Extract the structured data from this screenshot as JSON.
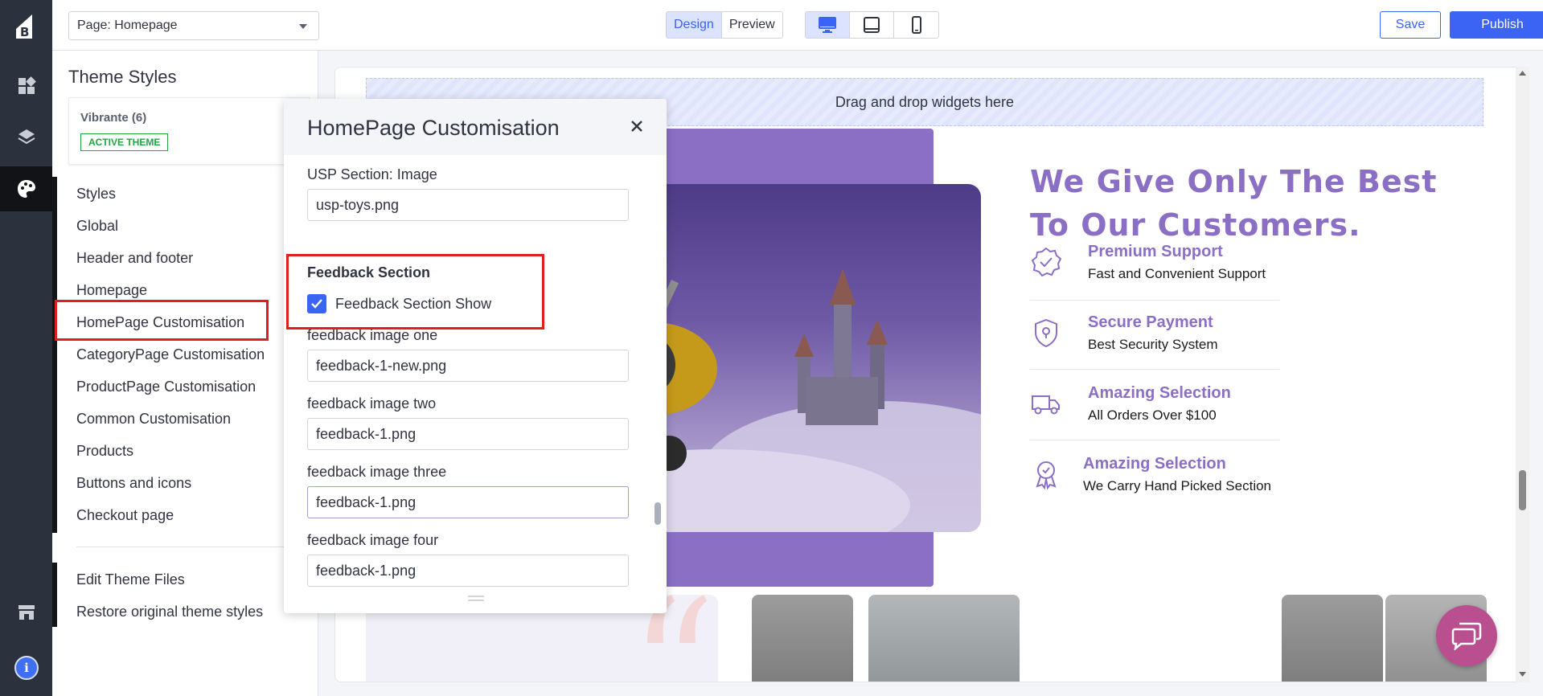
{
  "toolbar": {
    "page_select_value": "Page: Homepage",
    "mode_design": "Design",
    "mode_preview": "Preview",
    "save_label": "Save",
    "publish_label": "Publish"
  },
  "rail": {
    "icons": [
      "bigcommerce-logo-icon",
      "widgets-icon",
      "layers-icon",
      "palette-icon",
      "storefront-icon",
      "info-icon"
    ],
    "info_glyph": "i"
  },
  "sidepanel": {
    "title": "Theme Styles",
    "theme_name": "Vibrante (6)",
    "theme_badge": "ACTIVE THEME",
    "items": [
      "Styles",
      "Global",
      "Header and footer",
      "Homepage",
      "HomePage Customisation",
      "CategoryPage Customisation",
      "ProductPage Customisation",
      "Common Customisation",
      "Products",
      "Buttons and icons",
      "Checkout page"
    ],
    "footer_items": [
      "Edit Theme Files",
      "Restore original theme styles"
    ]
  },
  "modal": {
    "title": "HomePage Customisation",
    "usp_image_label": "USP Section: Image",
    "usp_image_value": "usp-toys.png",
    "feedback_section_label": "Feedback Section",
    "feedback_show_label": "Feedback Section Show",
    "feedback_show_checked": true,
    "fields": [
      {
        "label": "feedback image one",
        "value": "feedback-1-new.png"
      },
      {
        "label": "feedback image two",
        "value": "feedback-1.png"
      },
      {
        "label": "feedback image three",
        "value": "feedback-1.png"
      },
      {
        "label": "feedback image four",
        "value": "feedback-1.png"
      }
    ]
  },
  "preview": {
    "dropzone_text": "Drag and drop widgets here",
    "usp_title": "We Give Only The Best To Our Customers.",
    "usp_items": [
      {
        "title": "Premium Support",
        "subtitle": "Fast and Convenient Support",
        "icon": "badge-check-icon"
      },
      {
        "title": "Secure Payment",
        "subtitle": "Best Security System",
        "icon": "shield-icon"
      },
      {
        "title": "Amazing Selection",
        "subtitle": "All Orders Over $100",
        "icon": "truck-icon"
      },
      {
        "title": "Amazing Selection",
        "subtitle": "We Carry Hand Picked Section",
        "icon": "award-icon"
      }
    ]
  },
  "colors": {
    "accent": "#3c64f4",
    "brand_purple": "#8a6fc5",
    "highlight_red": "#e01e1e",
    "rail_dark": "#2c313e"
  }
}
